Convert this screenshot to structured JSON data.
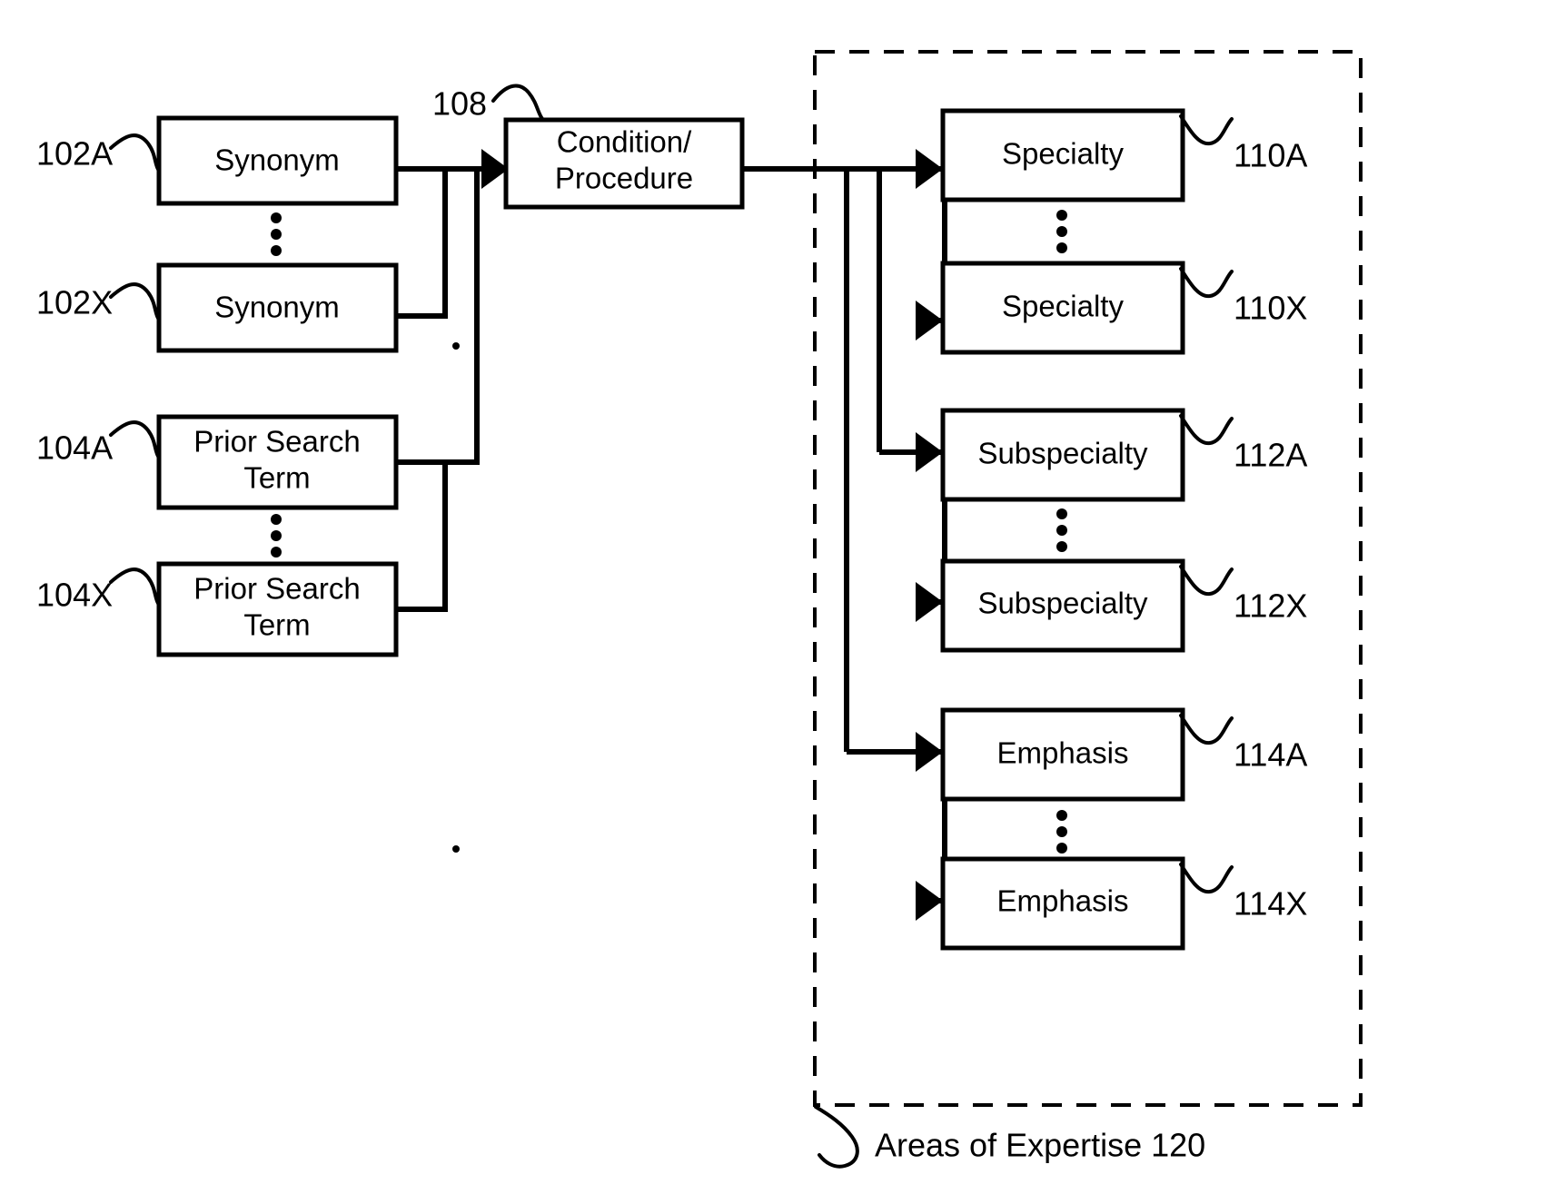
{
  "figure": {
    "title": "Condition/Procedure to Areas of Expertise mapping diagram",
    "background_color": "#ffffff",
    "line_color": "#000000"
  },
  "nodes": {
    "synonym_a": {
      "label": "Synonym",
      "ref": "102A"
    },
    "synonym_x": {
      "label": "Synonym",
      "ref": "102X"
    },
    "prior_search_term_a": {
      "label_line1": "Prior Search",
      "label_line2": "Term",
      "ref": "104A"
    },
    "prior_search_term_x": {
      "label_line1": "Prior Search",
      "label_line2": "Term",
      "ref": "104X"
    },
    "condition_procedure": {
      "label_line1": "Condition/",
      "label_line2": "Procedure",
      "ref": "108"
    },
    "specialty_a": {
      "label": "Specialty",
      "ref": "110A"
    },
    "specialty_x": {
      "label": "Specialty",
      "ref": "110X"
    },
    "subspecialty_a": {
      "label": "Subspecialty",
      "ref": "112A"
    },
    "subspecialty_x": {
      "label": "Subspecialty",
      "ref": "112X"
    },
    "emphasis_a": {
      "label": "Emphasis",
      "ref": "114A"
    },
    "emphasis_x": {
      "label": "Emphasis",
      "ref": "114X"
    }
  },
  "group": {
    "caption": "Areas of Expertise 120",
    "style": "dashed"
  },
  "vertical_ellipses_count": 5,
  "icons": {
    "arrow": "arrow-right-icon",
    "ellipsis": "vertical-ellipsis-icon",
    "leader": "curly-leader-line-icon"
  }
}
